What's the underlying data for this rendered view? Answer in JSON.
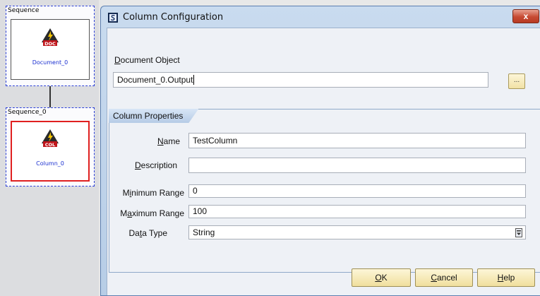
{
  "canvas": {
    "sequence_top": {
      "title": "Sequence",
      "node_label": "Document_0",
      "node_badge": "DOC"
    },
    "sequence_bottom": {
      "title": "Sequence_0",
      "node_label": "Column_0",
      "node_badge": "COL"
    }
  },
  "dialog": {
    "title": "Column Configuration",
    "close_label": "x",
    "document_object": {
      "label_first": "D",
      "label_rest": "ocument Object",
      "value": "Document_0.Output",
      "browse_label": "..."
    },
    "group": {
      "tab_label": "Column Properties",
      "name": {
        "pre": "",
        "u": "N",
        "post": "ame",
        "value": "TestColumn"
      },
      "description": {
        "pre": "",
        "u": "D",
        "post": "escription",
        "value": ""
      },
      "min_range": {
        "pre": "M",
        "u": "i",
        "post": "nimum Range",
        "value": "0"
      },
      "max_range": {
        "pre": "M",
        "u": "a",
        "post": "ximum Range",
        "value": "100"
      },
      "data_type": {
        "pre": "Da",
        "u": "t",
        "post": "a Type",
        "value": "String"
      }
    },
    "buttons": {
      "ok": {
        "u": "O",
        "rest": "K"
      },
      "cancel": {
        "u": "C",
        "rest": "ancel"
      },
      "help": {
        "u": "H",
        "rest": "elp"
      }
    }
  },
  "colors": {
    "canvas_bg": "#dcdde0",
    "dashed_border": "#2b3fd6",
    "selected_node_border": "#e02020",
    "node_label": "#1a2fd0",
    "button_gold": "#f0df9d",
    "close_red": "#c74a33"
  }
}
